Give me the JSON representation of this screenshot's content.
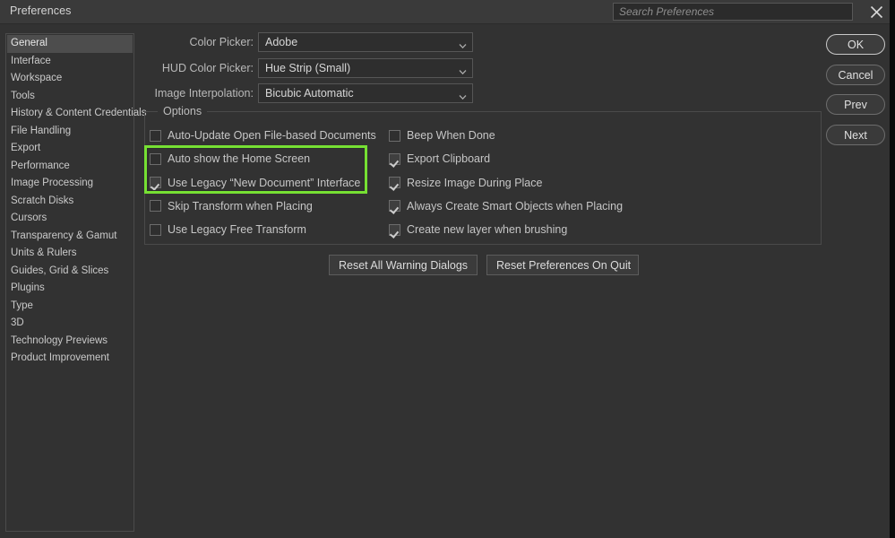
{
  "window": {
    "title": "Preferences",
    "close_icon": "close-icon"
  },
  "search": {
    "placeholder": "Search Preferences",
    "value": "",
    "icon": "search-icon"
  },
  "colors": {
    "window_bg": "#323232",
    "titlebar_bg": "#3a3a3a",
    "sidebar_selected_bg": "#4d4d4d",
    "accent_highlight": "#76e033",
    "text": "#c8c8c8",
    "field_bg": "#2e2e2e",
    "field_border": "#565656"
  },
  "sidebar": {
    "selected": "General",
    "items": [
      {
        "label": "General",
        "selected": true
      },
      {
        "label": "Interface",
        "selected": false
      },
      {
        "label": "Workspace",
        "selected": false
      },
      {
        "label": "Tools",
        "selected": false
      },
      {
        "label": "History & Content Credentials",
        "selected": false
      },
      {
        "label": "File Handling",
        "selected": false
      },
      {
        "label": "Export",
        "selected": false
      },
      {
        "label": "Performance",
        "selected": false
      },
      {
        "label": "Image Processing",
        "selected": false
      },
      {
        "label": "Scratch Disks",
        "selected": false
      },
      {
        "label": "Cursors",
        "selected": false
      },
      {
        "label": "Transparency & Gamut",
        "selected": false
      },
      {
        "label": "Units & Rulers",
        "selected": false
      },
      {
        "label": "Guides, Grid & Slices",
        "selected": false
      },
      {
        "label": "Plugins",
        "selected": false
      },
      {
        "label": "Type",
        "selected": false
      },
      {
        "label": "3D",
        "selected": false
      },
      {
        "label": "Technology Previews",
        "selected": false
      },
      {
        "label": "Product Improvement",
        "selected": false
      }
    ]
  },
  "main": {
    "dropdowns": [
      {
        "label": "Color Picker:",
        "value": "Adobe"
      },
      {
        "label": "HUD Color Picker:",
        "value": "Hue Strip (Small)"
      },
      {
        "label": "Image Interpolation:",
        "value": "Bicubic Automatic"
      }
    ],
    "options_group": {
      "legend": "Options",
      "left_column": [
        {
          "label": "Auto-Update Open File-based Documents",
          "checked": false
        },
        {
          "label": "Auto show the Home Screen",
          "checked": false
        },
        {
          "label": "Use Legacy “New Document” Interface",
          "checked": true
        },
        {
          "label": "Skip Transform when Placing",
          "checked": false
        },
        {
          "label": "Use Legacy Free Transform",
          "checked": false
        }
      ],
      "right_column": [
        {
          "label": "Beep When Done",
          "checked": false
        },
        {
          "label": "Export Clipboard",
          "checked": true
        },
        {
          "label": "Resize Image During Place",
          "checked": true
        },
        {
          "label": "Always Create Smart Objects when Placing",
          "checked": true
        },
        {
          "label": "Create new layer when brushing",
          "checked": true
        }
      ]
    },
    "reset_buttons": [
      {
        "label": "Reset All Warning Dialogs"
      },
      {
        "label": "Reset Preferences On Quit"
      }
    ]
  },
  "actions": {
    "buttons": [
      {
        "label": "OK",
        "primary": true
      },
      {
        "label": "Cancel",
        "primary": false
      },
      {
        "label": "Prev",
        "primary": false
      },
      {
        "label": "Next",
        "primary": false
      }
    ]
  },
  "annotation": {
    "type": "highlight-rectangle",
    "color": "#76e033",
    "targets": [
      "Auto show the Home Screen",
      "Use Legacy “New Document” Interface"
    ]
  }
}
